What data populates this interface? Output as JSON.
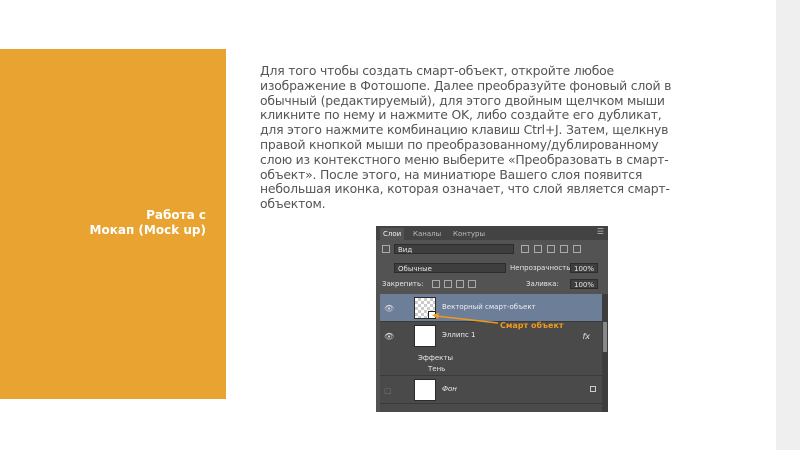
{
  "slide": {
    "title_lines": [
      "Работа с",
      "Мокап (Mock up)"
    ],
    "body_lines": [
      "Для того чтобы создать смарт-объект, откройте любое",
      "изображение в Фотошопе. Далее преобразуйте фоновый слой в",
      "обычный (редактируемый), для этого двойным щелчком мыши",
      "кликните по нему и нажмите OK, либо создайте его дубликат,",
      "для этого нажмите комбинацию клавиш Ctrl+J. Затем, щелкнув",
      "правой кнопкой мыши по преобразованному/дублированному",
      "слою из контекстного меню выберите «Преобразовать в смарт-",
      "объект». После этого, на миниатюре Вашего слоя появится",
      "небольшая иконка, которая означает, что слой является смарт-",
      "объектом."
    ],
    "colors": {
      "accent": "#E8A331",
      "text": "#545454",
      "annotation": "#F29A1B"
    }
  },
  "layers_panel": {
    "tabs": [
      "Слои",
      "Каналы",
      "Контуры"
    ],
    "filter_value": "Вид",
    "blend_mode": "Обычные",
    "opacity_label": "Непрозрачность:",
    "opacity_value": "100%",
    "lock_label": "Закрепить:",
    "fill_label": "Заливка:",
    "fill_value": "100%",
    "layers": [
      {
        "name": "Векторный смарт-объект"
      },
      {
        "name": "Эллипс 1",
        "fx": "fx"
      },
      {
        "name": "Фон"
      }
    ],
    "effects_label": "Эффекты",
    "shadow_label": "Тень",
    "annotation": "Смарт объект",
    "icons": {
      "eye": "eye-icon",
      "lock": "lock-icon",
      "fx": "fx-icon"
    }
  }
}
